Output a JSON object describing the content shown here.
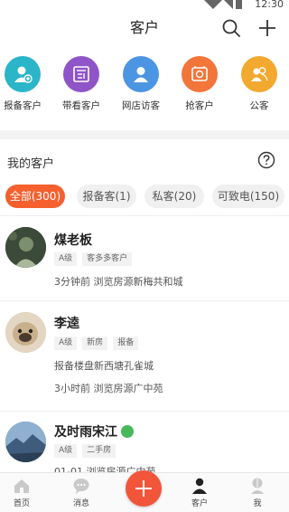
{
  "status_bar": {
    "time": "12:30"
  },
  "header": {
    "title": "客户",
    "search_icon": "search-icon",
    "add_icon": "plus-icon"
  },
  "quick_actions": [
    {
      "label": "报备客户",
      "color": "#2bb5c9",
      "icon": "user-add-icon"
    },
    {
      "label": "带看客户",
      "color": "#8f54c8",
      "icon": "calendar-icon"
    },
    {
      "label": "网店访客",
      "color": "#4c95e3",
      "icon": "user-icon"
    },
    {
      "label": "抢客户",
      "color": "#f2753a",
      "icon": "phone-icon"
    },
    {
      "label": "公客",
      "color": "#f3a82f",
      "icon": "group-icon"
    }
  ],
  "section": {
    "title": "我的客户",
    "help_icon": "question-icon"
  },
  "filter_tabs": [
    {
      "label": "全部(300)",
      "active": true
    },
    {
      "label": "报备客(1)",
      "active": false
    },
    {
      "label": "私客(20)",
      "active": false
    },
    {
      "label": "可致电(150)",
      "active": false
    }
  ],
  "customers": [
    {
      "name": "煤老板",
      "badges": [
        "A级",
        "客多多客户"
      ],
      "lines": [
        "3分钟前 浏览房源新梅共和城"
      ]
    },
    {
      "name": "李逵",
      "badges": [
        "A级",
        "新房",
        "报备"
      ],
      "lines": [
        "报备楼盘新西塘孔雀城",
        "3小时前 浏览房源广中苑"
      ]
    },
    {
      "name": "及时雨宋江",
      "badges": [
        "A级",
        "二手房"
      ],
      "lines": [
        "01-01 浏览房源广中苑"
      ],
      "wechat": true
    }
  ],
  "tabbar": [
    {
      "label": "首页",
      "icon": "home-icon"
    },
    {
      "label": "消息",
      "icon": "message-icon"
    },
    {
      "label": "客户",
      "icon": "customer-icon",
      "active": true
    },
    {
      "label": "我",
      "icon": "me-icon"
    }
  ],
  "colors": {
    "accent": "#f5602e",
    "fab": "#f2553a"
  }
}
